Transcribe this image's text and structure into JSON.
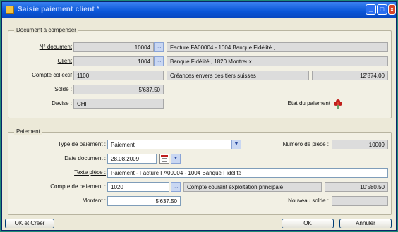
{
  "window": {
    "title": "Saisie paiement client *",
    "min": "_",
    "max": "□",
    "close": "x"
  },
  "document_section": {
    "legend": "Document à compenser",
    "n_document_label": "N° document",
    "n_document_value": "10004",
    "n_document_desc": "Facture FA00004 - 1004 Banque Fidélité ,",
    "client_label": "Client",
    "client_value": "1004",
    "client_desc": "Banque Fidélité , 1820 Montreux",
    "compte_collectif_label": "Compte collectif",
    "compte_collectif_value": "1100",
    "compte_collectif_desc": "Créances envers des tiers suisses",
    "compte_collectif_amount": "12'874.00",
    "solde_label": "Solde :",
    "solde_value": "5'637.50",
    "devise_label": "Devise :",
    "devise_value": "CHF",
    "etat_label": "Etat du paiement"
  },
  "payment_section": {
    "legend": "Paiement",
    "type_label": "Type de paiement :",
    "type_value": "Paiement",
    "numero_label": "Numéro de pièce :",
    "numero_value": "10009",
    "date_label": "Date document :",
    "date_value": "28.08.2009",
    "texte_label": "Texte pièce :",
    "texte_value": "Paiement - Facture FA00004 - 1004 Banque Fidélité",
    "compte_label": "Compte de paiement :",
    "compte_value": "1020",
    "compte_desc": "Compte courant exploitation principale",
    "compte_amount": "10'580.50",
    "montant_label": "Montant :",
    "montant_value": "5'637.50",
    "nouveau_solde_label": "Nouveau solde :",
    "nouveau_solde_value": ""
  },
  "buttons": {
    "ok_creer": "OK et Créer",
    "ok": "OK",
    "annuler": "Annuler"
  },
  "icons": {
    "dropdown": "▼",
    "lookup": "…",
    "date_arrow": "▼"
  }
}
